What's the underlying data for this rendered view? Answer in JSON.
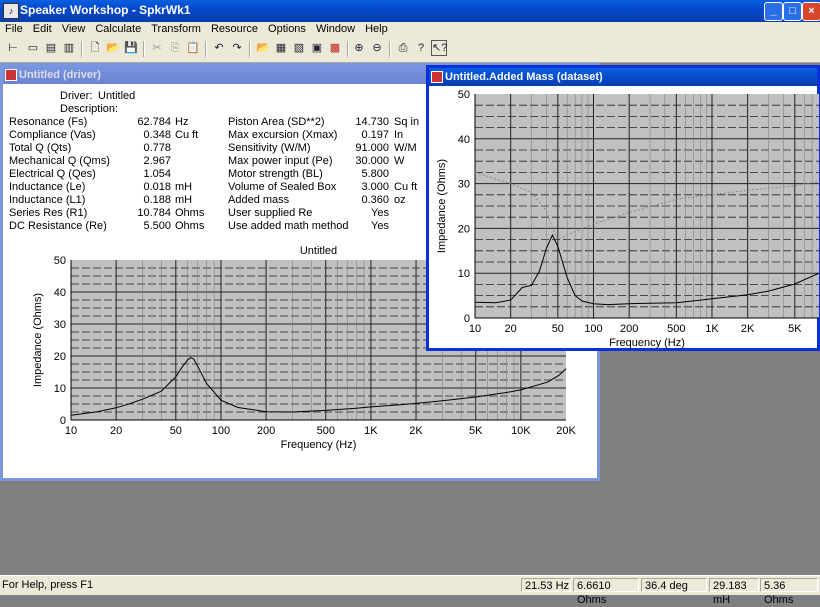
{
  "app": {
    "title": "Speaker Workshop - SpkrWk1"
  },
  "menu": [
    "File",
    "Edit",
    "View",
    "Calculate",
    "Transform",
    "Resource",
    "Options",
    "Window",
    "Help"
  ],
  "driver_window": {
    "title": "Untitled (driver)",
    "driver_label": "Driver:",
    "driver_value": "Untitled",
    "description_label": "Description:",
    "left_params": [
      {
        "label": "Resonance (Fs)",
        "value": "62.784",
        "unit": "Hz"
      },
      {
        "label": "Compliance (Vas)",
        "value": "0.348",
        "unit": "Cu ft"
      },
      {
        "label": "Total Q (Qts)",
        "value": "0.778",
        "unit": ""
      },
      {
        "label": "Mechanical Q (Qms)",
        "value": "2.967",
        "unit": ""
      },
      {
        "label": "Electrical Q (Qes)",
        "value": "1.054",
        "unit": ""
      },
      {
        "label": "Inductance (Le)",
        "value": "0.018",
        "unit": "mH"
      },
      {
        "label": "Inductance (L1)",
        "value": "0.188",
        "unit": "mH"
      },
      {
        "label": "Series Res (R1)",
        "value": "10.784",
        "unit": "Ohms"
      },
      {
        "label": "DC Resistance (Re)",
        "value": "5.500",
        "unit": "Ohms"
      }
    ],
    "right_params": [
      {
        "label": "Piston Area (SD**2)",
        "value": "14.730",
        "unit": "Sq in"
      },
      {
        "label": "Max excursion (Xmax)",
        "value": "0.197",
        "unit": "In"
      },
      {
        "label": "Sensitivity (W/M)",
        "value": "91.000",
        "unit": "W/M"
      },
      {
        "label": "Max power input (Pe)",
        "value": "30.000",
        "unit": "W"
      },
      {
        "label": "Motor strength (BL)",
        "value": "5.800",
        "unit": ""
      },
      {
        "label": "Volume of Sealed Box",
        "value": "3.000",
        "unit": "Cu ft"
      },
      {
        "label": "Added mass",
        "value": "0.360",
        "unit": "oz"
      },
      {
        "label": "User supplied Re",
        "value": "Yes",
        "unit": ""
      },
      {
        "label": "Use added math method",
        "value": "Yes",
        "unit": ""
      }
    ]
  },
  "dataset_window": {
    "title": "Untitled.Added Mass (dataset)"
  },
  "chart_data": [
    {
      "type": "line",
      "title": "Untitled",
      "xlabel": "Frequency (Hz)",
      "ylabel": "Impedance (Ohms)",
      "x_scale": "log",
      "xlim": [
        10,
        20000
      ],
      "ylim": [
        0,
        50
      ],
      "x_ticks": [
        {
          "v": 10,
          "t": "10"
        },
        {
          "v": 20,
          "t": "20"
        },
        {
          "v": 50,
          "t": "50"
        },
        {
          "v": 100,
          "t": "100"
        },
        {
          "v": 200,
          "t": "200"
        },
        {
          "v": 500,
          "t": "500"
        },
        {
          "v": 1000,
          "t": "1K"
        },
        {
          "v": 2000,
          "t": "2K"
        },
        {
          "v": 5000,
          "t": "5K"
        },
        {
          "v": 10000,
          "t": "10K"
        },
        {
          "v": 20000,
          "t": "20K"
        }
      ],
      "y_ticks": [
        0,
        10,
        20,
        30,
        40,
        50
      ],
      "grid": true,
      "series": [
        {
          "color": "#000000",
          "x": [
            10,
            15,
            20,
            25,
            30,
            40,
            50,
            55,
            60,
            63,
            66,
            70,
            80,
            100,
            130,
            200,
            300,
            500,
            800,
            1000,
            1500,
            2000,
            3000,
            5000,
            8000,
            10000,
            15000,
            18000,
            20000
          ],
          "y": [
            1.5,
            2.6,
            3.8,
            5.2,
            6.5,
            9.0,
            13.5,
            16.5,
            18.8,
            19.5,
            19.0,
            16.8,
            11.5,
            6.2,
            3.9,
            2.6,
            2.5,
            3.0,
            3.7,
            4.1,
            4.7,
            5.2,
            6.0,
            7.2,
            8.6,
            9.4,
            11.8,
            14.0,
            16.0
          ]
        }
      ]
    },
    {
      "type": "line",
      "title": "",
      "xlabel": "Frequency (Hz)",
      "ylabel": "Impedance (Ohms)",
      "x_scale": "log",
      "xlim": [
        10,
        8000
      ],
      "ylim": [
        0,
        50
      ],
      "x_ticks": [
        {
          "v": 10,
          "t": "10"
        },
        {
          "v": 20,
          "t": "20"
        },
        {
          "v": 50,
          "t": "50"
        },
        {
          "v": 100,
          "t": "100"
        },
        {
          "v": 200,
          "t": "200"
        },
        {
          "v": 500,
          "t": "500"
        },
        {
          "v": 1000,
          "t": "1K"
        },
        {
          "v": 2000,
          "t": "2K"
        },
        {
          "v": 5000,
          "t": "5K"
        }
      ],
      "y_ticks": [
        0,
        10,
        20,
        30,
        40,
        50
      ],
      "grid": true,
      "series": [
        {
          "color": "#000000",
          "x": [
            10,
            15,
            20,
            25,
            30,
            35,
            40,
            45,
            50,
            60,
            70,
            80,
            100,
            130,
            200,
            300,
            500,
            800,
            1000,
            2000,
            3000,
            5000,
            8000
          ],
          "y": [
            3.5,
            3.4,
            4.0,
            6.8,
            7.3,
            10.5,
            15.5,
            18.5,
            16.0,
            9.0,
            5.0,
            3.8,
            3.2,
            3.0,
            3.2,
            3.3,
            3.4,
            4.0,
            4.3,
            5.2,
            6.0,
            7.6,
            10.0
          ]
        },
        {
          "color": "#888888",
          "dashed": true,
          "x": [
            10,
            15,
            20,
            30,
            40,
            45,
            50,
            60,
            100,
            200,
            500,
            1000,
            2000,
            5000,
            8000
          ],
          "y": [
            32.5,
            31.0,
            30.0,
            28.0,
            24.0,
            20.0,
            17.5,
            18.5,
            21.0,
            23.5,
            26.5,
            27.5,
            28.5,
            29.5,
            30.5
          ]
        }
      ]
    }
  ],
  "status": {
    "help": "For Help, press F1",
    "freq": "21.53 Hz",
    "ohms": "6.6610 Ohms",
    "deg": "36.4 deg",
    "mh": "29.183 mH",
    "ohms2": "5.36 Ohms"
  }
}
